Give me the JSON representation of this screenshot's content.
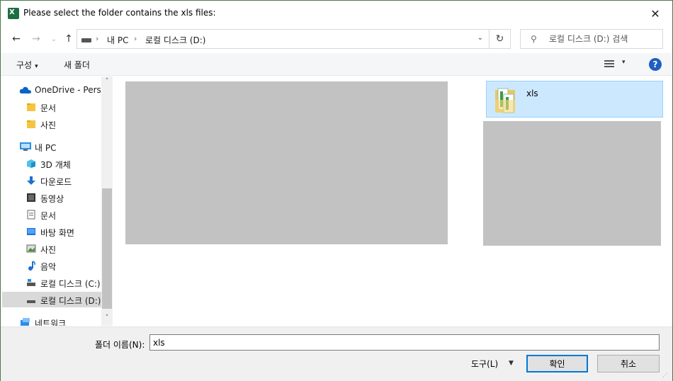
{
  "dialog": {
    "title": "Please select the folder contains the xls files:",
    "app_icon_letter": "X",
    "close_glyph": "✕"
  },
  "nav": {
    "back_glyph": "←",
    "forward_glyph": "→",
    "recent_glyph": "⌄",
    "up_glyph": "↑",
    "breadcrumb": [
      "내 PC",
      "로컬 디스크 (D:)"
    ],
    "breadcrumb_sep": "›",
    "dropdown_glyph": "⌄",
    "refresh_glyph": "↻",
    "search_placeholder": "로컬 디스크 (D:) 검색",
    "search_glyph": "⚲"
  },
  "toolbar": {
    "organize_label": "구성",
    "new_folder_label": "새 폴더",
    "caret": "▾",
    "help_label": "?"
  },
  "sidebar": {
    "items": [
      {
        "label": "OneDrive - Personal",
        "icon": "cloud-icon"
      },
      {
        "label": "문서",
        "icon": "folder-icon"
      },
      {
        "label": "사진",
        "icon": "folder-icon"
      },
      {
        "label": "내 PC",
        "icon": "computer-icon"
      },
      {
        "label": "3D 개체",
        "icon": "cube-icon"
      },
      {
        "label": "다운로드",
        "icon": "download-icon"
      },
      {
        "label": "동영상",
        "icon": "film-icon"
      },
      {
        "label": "문서",
        "icon": "document-icon"
      },
      {
        "label": "바탕 화면",
        "icon": "desktop-icon"
      },
      {
        "label": "사진",
        "icon": "picture-icon"
      },
      {
        "label": "음악",
        "icon": "music-icon"
      },
      {
        "label": "로컬 디스크 (C:)",
        "icon": "drive-c-icon"
      },
      {
        "label": "로컬 디스크 (D:)",
        "icon": "drive-d-icon"
      },
      {
        "label": "네트워크",
        "icon": "network-icon"
      }
    ],
    "scroll_up": "˄",
    "scroll_down": "˅"
  },
  "content": {
    "folder_name": "xls"
  },
  "footer": {
    "folder_name_label": "폴더 이름(N):",
    "folder_name_value": "xls",
    "tools_label": "도구(L)",
    "tools_caret": "▼",
    "ok_label": "확인",
    "cancel_label": "취소"
  },
  "colors": {
    "selection": "#cce8ff",
    "accent": "#0078d7",
    "excel_green": "#1d6f42",
    "placeholder_grey": "#c2c2c2"
  }
}
